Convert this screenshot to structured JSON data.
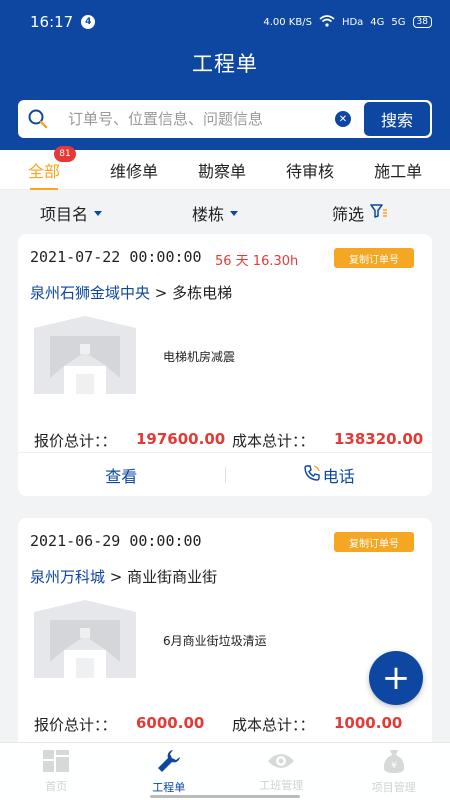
{
  "status_bar": {
    "time": "16:17",
    "notification_count": "4",
    "net_speed": "4.00 KB/S",
    "hd_label": "HDa",
    "signal_1": "4G",
    "signal_2": "5G",
    "battery": "38"
  },
  "header": {
    "title": "工程单"
  },
  "search": {
    "placeholder": "订单号、位置信息、问题信息",
    "button_label": "搜索"
  },
  "tabs": [
    {
      "label": "全部",
      "badge": "81",
      "active": true
    },
    {
      "label": "维修单"
    },
    {
      "label": "勘察单"
    },
    {
      "label": "待审核"
    },
    {
      "label": "施工单"
    }
  ],
  "filters": {
    "project": "项目名",
    "building": "楼栋",
    "filter": "筛选"
  },
  "orders": [
    {
      "datetime": "2021-07-22 00:00:00",
      "remaining": "56 天 16.30h",
      "copy_label": "复制订单号",
      "city": "泉州石狮金域中央",
      "sep": " > ",
      "location": "多栋电梯",
      "description": "电梯机房减震",
      "quote_label": "报价总计：：",
      "quote_value": "197600.00",
      "cost_label": "成本总计：：",
      "cost_value": "138320.00",
      "view_label": "查看",
      "phone_label": "电话"
    },
    {
      "datetime": "2021-06-29 00:00:00",
      "copy_label": "复制订单号",
      "city": "泉州万科城",
      "sep": " > ",
      "location": "商业街商业街",
      "description": "6月商业街垃圾清运",
      "quote_label": "报价总计：：",
      "quote_value": "6000.00",
      "cost_label": "成本总计：：",
      "cost_value": "1000.00"
    }
  ],
  "fab_symbol": "+",
  "bottom_nav": [
    {
      "label": "首页"
    },
    {
      "label": "工程单",
      "active": true
    },
    {
      "label": "工班管理"
    },
    {
      "label": "项目管理"
    }
  ],
  "colors": {
    "primary": "#0d47a1",
    "accent": "#f5a623",
    "danger": "#e53935"
  }
}
